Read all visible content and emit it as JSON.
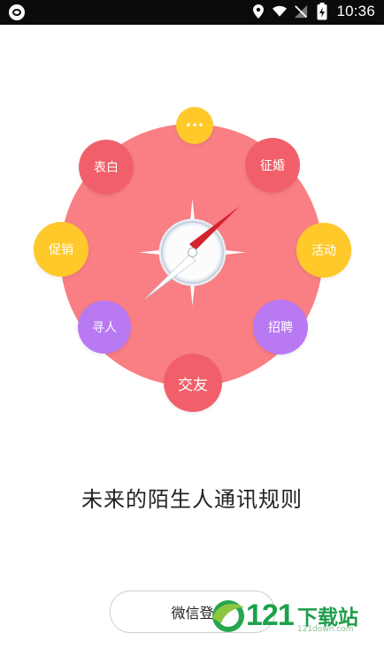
{
  "status_bar": {
    "time": "10:36"
  },
  "wheel": {
    "bubbles": {
      "more": "•••",
      "biaobai": "表白",
      "zhenghun": "征婚",
      "cuxiao": "促销",
      "huodong": "活动",
      "xunren": "寻人",
      "zhaopin": "招聘",
      "jiaoyou": "交友"
    }
  },
  "tagline": "未来的陌生人通讯规则",
  "login_button": "微信登",
  "watermark": {
    "number": "121",
    "text": "下载站",
    "url": "121down.com"
  },
  "colors": {
    "wheel": "#f97f84",
    "red_bubble": "#f1606a",
    "yellow_bubble": "#ffc92a",
    "purple_bubble": "#b879f2",
    "compass_needle": "#d4232d"
  }
}
